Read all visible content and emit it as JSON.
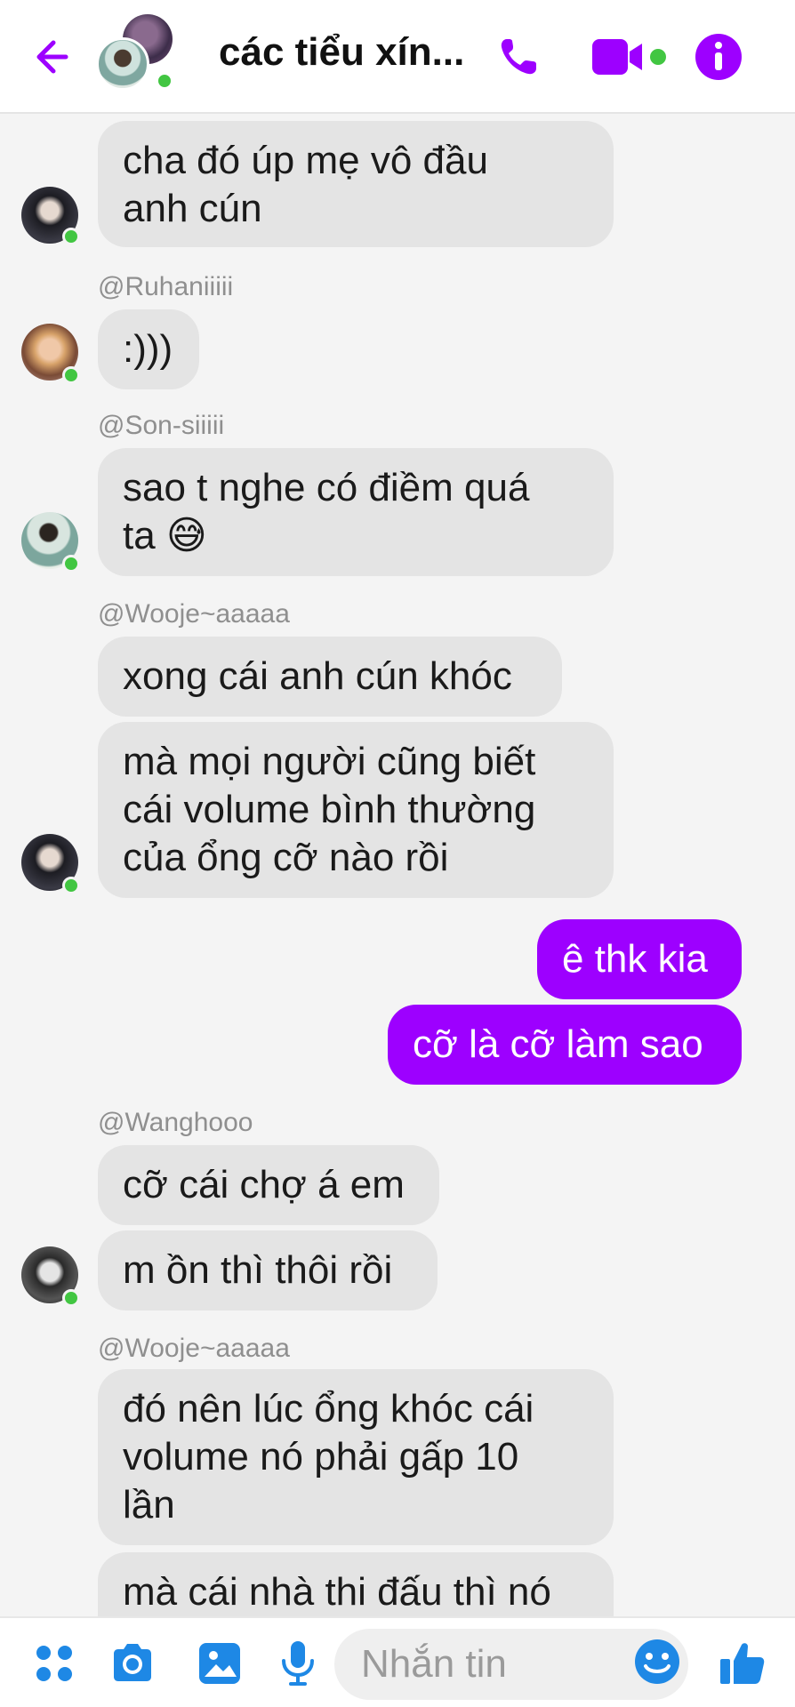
{
  "header": {
    "title": "các tiểu xín...",
    "accent": "#9d00ff"
  },
  "messages": [
    {
      "text_lines": [
        "cha đó úp mẹ vô đầu",
        "anh cún"
      ]
    },
    {
      "sender": "@Ruhaniiiii",
      "text": ":)))"
    },
    {
      "sender": "@Son-siiiii",
      "text_lines": [
        "sao t nghe có điềm quá",
        "ta 😅"
      ]
    },
    {
      "sender": "@Wooje~aaaaa",
      "text": "xong cái anh cún khóc"
    },
    {
      "text_lines": [
        "mà mọi người cũng biết",
        "cái volume bình thường",
        "của ổng cỡ nào rồi"
      ]
    },
    {
      "text": "ê thk kia"
    },
    {
      "text": "cỡ là cỡ làm sao"
    },
    {
      "sender": "@Wanghooo",
      "text": "cỡ cái chợ á em"
    },
    {
      "text": "m ồn thì thôi rồi"
    },
    {
      "sender": "@Wooje~aaaaa",
      "text_lines": [
        "đó nên lúc ổng khóc cái",
        "volume nó phải gấp 10",
        "lần"
      ]
    },
    {
      "text": "mà cái nhà thi đấu thì nó"
    }
  ],
  "composer": {
    "placeholder": "Nhắn tin",
    "icons": [
      "apps-icon",
      "camera-icon",
      "image-icon",
      "microphone-icon",
      "emoji-icon",
      "like-icon"
    ]
  }
}
